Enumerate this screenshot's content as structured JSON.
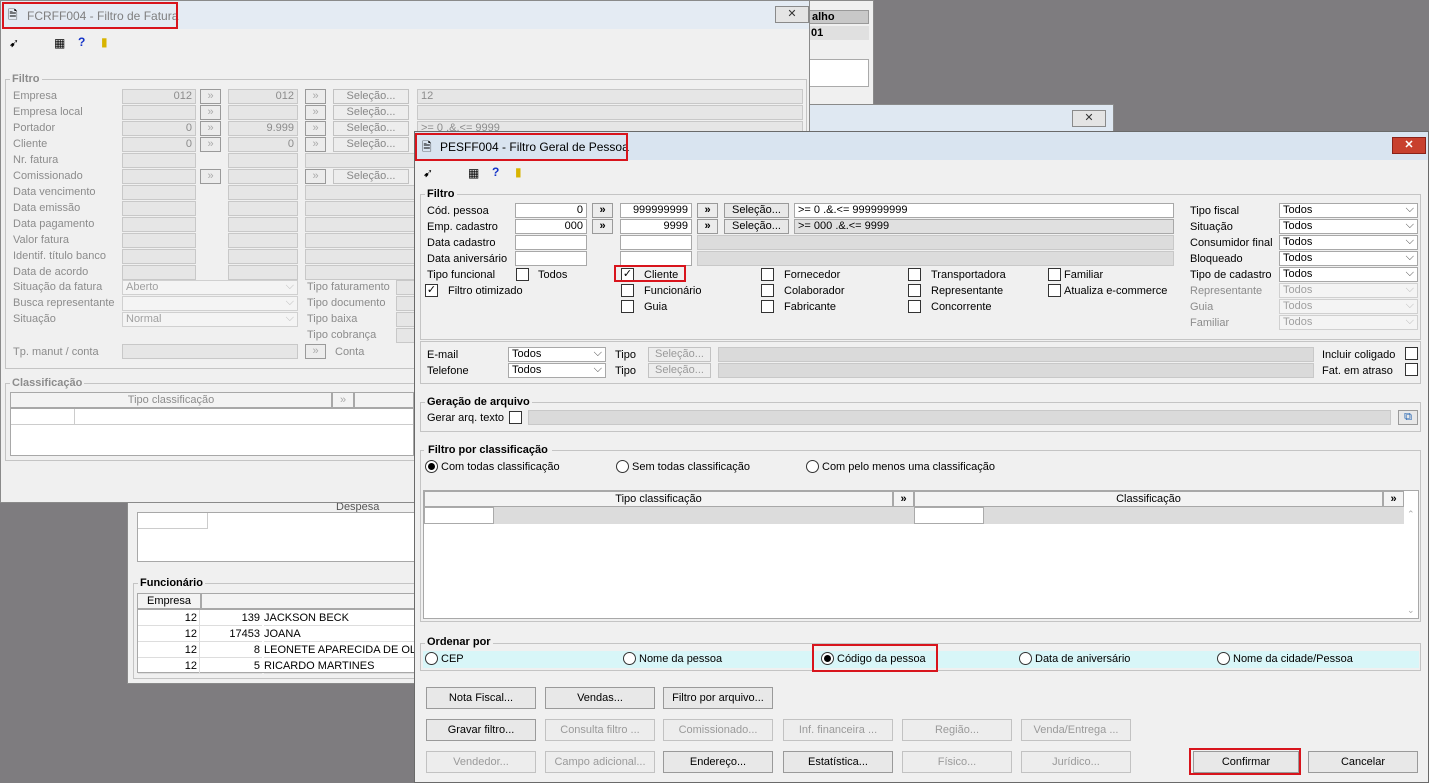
{
  "bg_window": {
    "header_fragment": "alho",
    "header_value": "01",
    "despesa_label": "Despesa",
    "funcionario": {
      "title": "Funcionário",
      "column": "Empresa",
      "rows": [
        {
          "empresa": "12",
          "codigo": "139",
          "nome": "JACKSON BECK"
        },
        {
          "empresa": "12",
          "codigo": "17453",
          "nome": "JOANA"
        },
        {
          "empresa": "12",
          "codigo": "8",
          "nome": "LEONETE APARECIDA DE OLIV"
        },
        {
          "empresa": "12",
          "codigo": "5",
          "nome": "RICARDO MARTINES"
        }
      ]
    }
  },
  "fatura": {
    "title": "FCRFF004 - Filtro de Fatura",
    "filtro_title": "Filtro",
    "rows": [
      {
        "label": "Empresa",
        "from": "012",
        "to": "012",
        "btn": "Seleção...",
        "range": "12"
      },
      {
        "label": "Empresa local",
        "from": "",
        "to": "",
        "btn": "Seleção...",
        "range": ""
      },
      {
        "label": "Portador",
        "from": "0",
        "to": "9.999",
        "btn": "Seleção...",
        "range": ">= 0 .&.<= 9999"
      },
      {
        "label": "Cliente",
        "from": "0",
        "to": "0",
        "btn": "Seleção...",
        "range": ""
      },
      {
        "label": "Nr. fatura"
      },
      {
        "label": "Comissionado",
        "btn": "Seleção..."
      },
      {
        "label": "Data vencimento"
      },
      {
        "label": "Data emissão"
      },
      {
        "label": "Data pagamento"
      },
      {
        "label": "Valor fatura"
      },
      {
        "label": "Identif. título banco"
      },
      {
        "label": "Data de acordo"
      }
    ],
    "situacao_fatura": {
      "label": "Situação da fatura",
      "value": "Aberto"
    },
    "busca_representante": {
      "label": "Busca representante",
      "value": ""
    },
    "situacao": {
      "label": "Situação",
      "value": "Normal"
    },
    "tp_manut": {
      "label": "Tp. manut / conta",
      "conta": "Conta"
    },
    "right_labels": [
      "Tipo faturamento",
      "Tipo documento",
      "Tipo baixa",
      "Tipo cobrança"
    ],
    "classificacao_title": "Classificação",
    "classificacao_col": "Tipo classificação"
  },
  "pessoa": {
    "title": "PESFF004 - Filtro Geral de Pessoa",
    "filtro_title": "Filtro",
    "cod_pessoa": {
      "label": "Cód. pessoa",
      "from": "0",
      "to": "999999999",
      "btn": "Seleção...",
      "range": ">= 0 .&.<= 999999999"
    },
    "emp_cadastro": {
      "label": "Emp. cadastro",
      "from": "000",
      "to": "9999",
      "btn": "Seleção...",
      "range": ">= 000 .&.<= 9999"
    },
    "data_cadastro": "Data cadastro",
    "data_aniversario": "Data aniversário",
    "tipo_funcional": "Tipo funcional",
    "filtro_otimizado": "Filtro otimizado",
    "checks": {
      "todos": "Todos",
      "cliente": "Cliente",
      "funcionario": "Funcionário",
      "guia": "Guia",
      "fornecedor": "Fornecedor",
      "colaborador": "Colaborador",
      "fabricante": "Fabricante",
      "transportadora": "Transportadora",
      "representante": "Representante",
      "concorrente": "Concorrente",
      "familiar": "Familiar",
      "atualiza": "Atualiza e-commerce"
    },
    "right_fields": [
      {
        "label": "Tipo fiscal",
        "value": "Todos",
        "enabled": true
      },
      {
        "label": "Situação",
        "value": "Todos",
        "enabled": true
      },
      {
        "label": "Consumidor final",
        "value": "Todos",
        "enabled": true
      },
      {
        "label": "Bloqueado",
        "value": "Todos",
        "enabled": true
      },
      {
        "label": "Tipo de cadastro",
        "value": "Todos",
        "enabled": true
      },
      {
        "label": "Representante",
        "value": "Todos",
        "enabled": false
      },
      {
        "label": "Guia",
        "value": "Todos",
        "enabled": false
      },
      {
        "label": "Familiar",
        "value": "Todos",
        "enabled": false
      }
    ],
    "email": {
      "label": "E-mail",
      "value": "Todos",
      "tipo": "Tipo",
      "btn": "Seleção..."
    },
    "telefone": {
      "label": "Telefone",
      "value": "Todos",
      "tipo": "Tipo",
      "btn": "Seleção..."
    },
    "incluir_coligado": "Incluir coligado",
    "fat_atraso": "Fat. em atraso",
    "geracao": {
      "title": "Geração de arquivo",
      "label": "Gerar arq. texto"
    },
    "filtro_class": {
      "title": "Filtro por classificação",
      "opt1": "Com todas classificação",
      "opt2": "Sem todas classificação",
      "opt3": "Com pelo menos uma classificação",
      "col1": "Tipo classificação",
      "col2": "Classificação"
    },
    "ordenar": {
      "title": "Ordenar por",
      "cep": "CEP",
      "nome": "Nome da pessoa",
      "codigo": "Código da pessoa",
      "aniversario": "Data de aniversário",
      "cidade": "Nome da cidade/Pessoa"
    },
    "buttons": {
      "nota_fiscal": "Nota Fiscal...",
      "vendas": "Vendas...",
      "filtro_arquivo": "Filtro por arquivo...",
      "gravar": "Gravar filtro...",
      "consulta": "Consulta filtro ...",
      "comissionado": "Comissionado...",
      "inf_fin": "Inf. financeira ...",
      "regiao": "Região...",
      "venda_entrega": "Venda/Entrega ...",
      "vendedor": "Vendedor...",
      "campo_adic": "Campo adicional...",
      "endereco": "Endereço...",
      "estatistica": "Estatística...",
      "fisico": "Físico...",
      "juridico": "Jurídico...",
      "confirmar": "Confirmar",
      "cancelar": "Cancelar"
    }
  },
  "colors": {
    "accent_red": "#d8141c",
    "highlight_row": "#d8f6f8",
    "title_bar": "#dde9f5"
  }
}
